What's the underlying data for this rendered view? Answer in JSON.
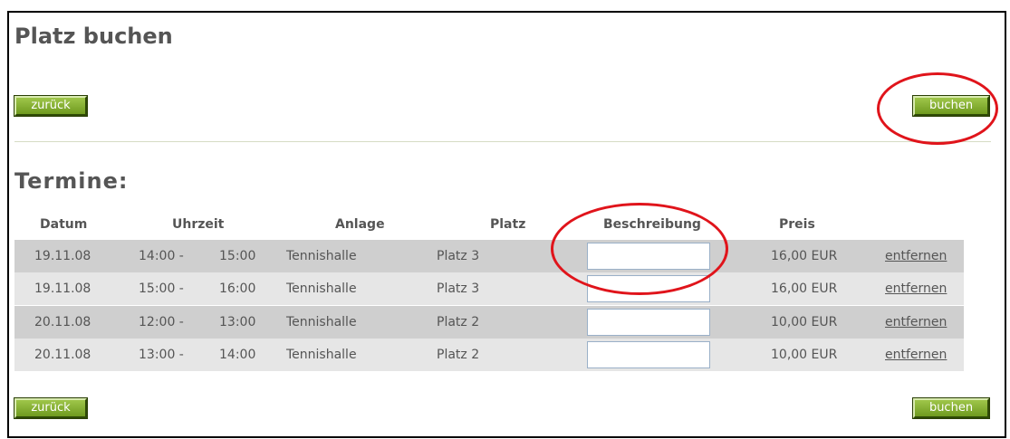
{
  "page": {
    "title": "Platz buchen",
    "section_title": "Termine:"
  },
  "buttons": {
    "back_label": "zurück",
    "book_label": "buchen"
  },
  "table": {
    "columns": [
      "Datum",
      "Uhrzeit",
      "Anlage",
      "Platz",
      "Beschreibung",
      "Preis"
    ],
    "rows": [
      {
        "date": "19.11.08",
        "time_from": "14:00 -",
        "time_to": "15:00",
        "facility": "Tennishalle",
        "court": "Platz 3",
        "description": "",
        "price": "16,00 EUR",
        "action": "entfernen"
      },
      {
        "date": "19.11.08",
        "time_from": "15:00 -",
        "time_to": "16:00",
        "facility": "Tennishalle",
        "court": "Platz 3",
        "description": "",
        "price": "16,00 EUR",
        "action": "entfernen"
      },
      {
        "date": "20.11.08",
        "time_from": "12:00 -",
        "time_to": "13:00",
        "facility": "Tennishalle",
        "court": "Platz 2",
        "description": "",
        "price": "10,00 EUR",
        "action": "entfernen"
      },
      {
        "date": "20.11.08",
        "time_from": "13:00 -",
        "time_to": "14:00",
        "facility": "Tennishalle",
        "court": "Platz 2",
        "description": "",
        "price": "10,00 EUR",
        "action": "entfernen"
      }
    ]
  },
  "colors": {
    "button_green": "#7fa82e",
    "row_dark": "#cfcfcf",
    "row_light": "#e6e6e6",
    "annotation_red": "#e0141b"
  }
}
